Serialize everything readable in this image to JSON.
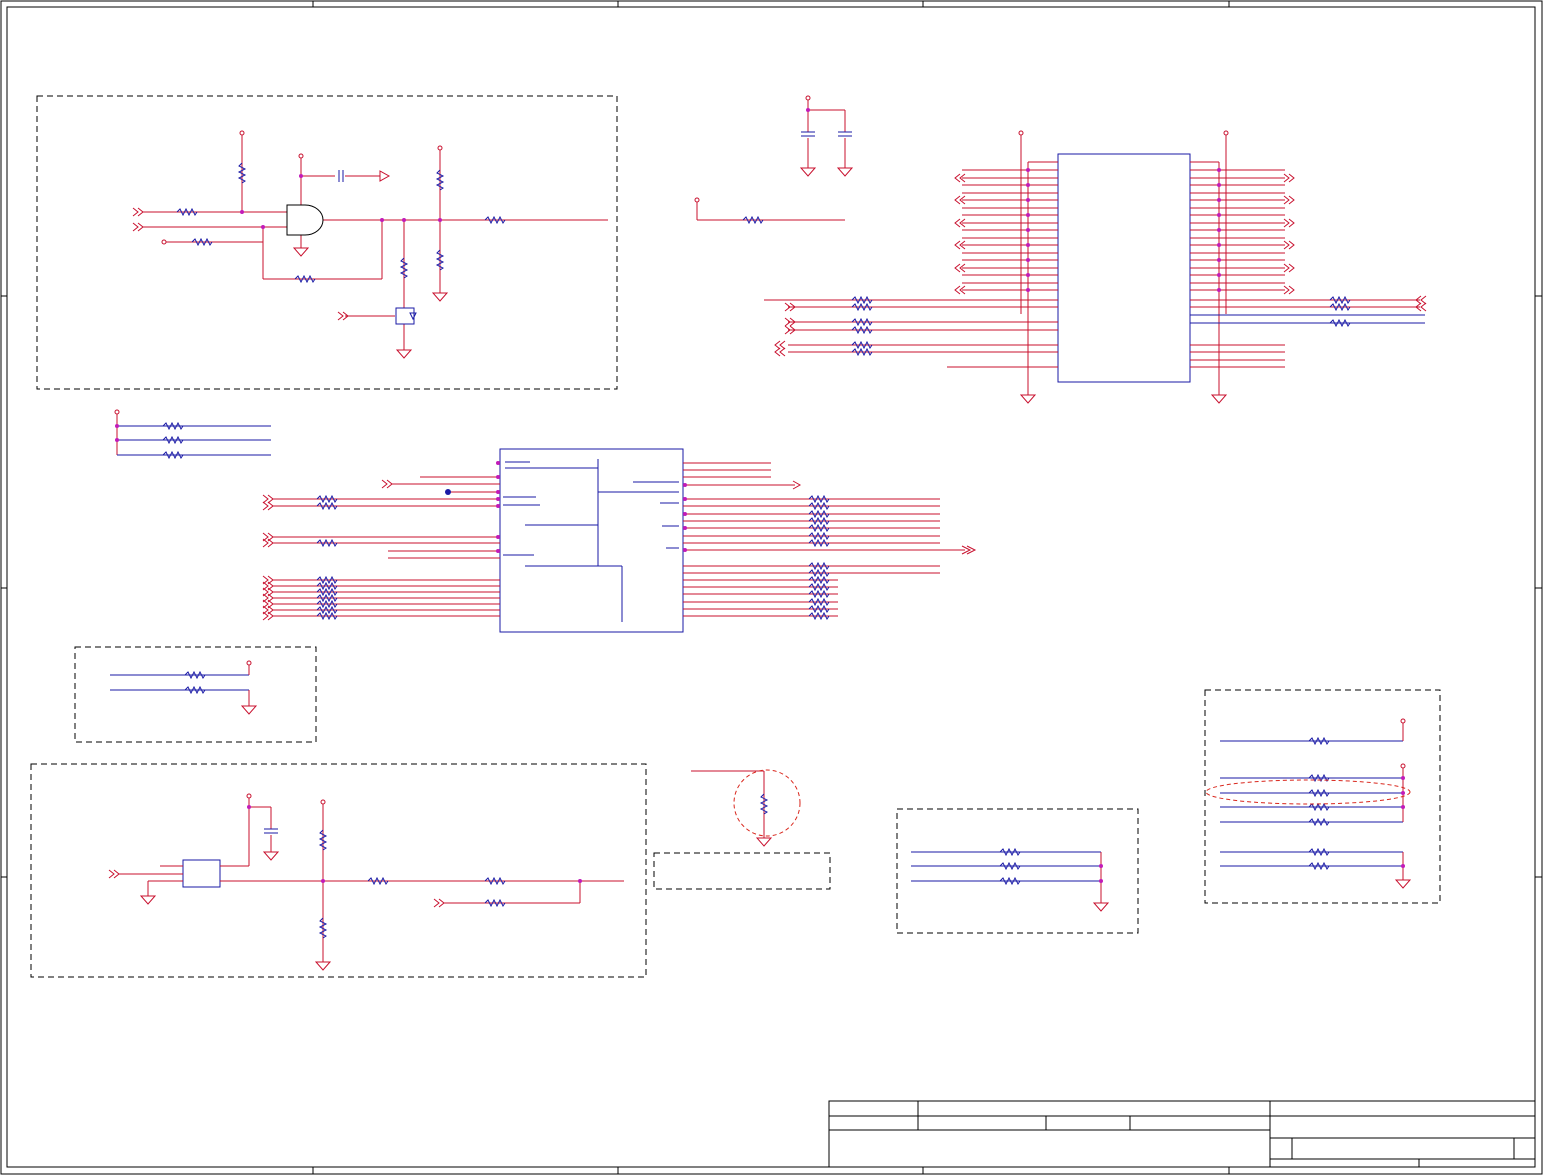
{
  "sheet": {
    "colors": {
      "wire": "#c8102e",
      "component": "#1a1aa6",
      "border": "#000000",
      "junction": "#c21bb8"
    },
    "zone_columns": 5,
    "zone_rows": 4
  },
  "title_block": {
    "title": "",
    "drawing_number": "",
    "revision": "",
    "sheet": ""
  }
}
